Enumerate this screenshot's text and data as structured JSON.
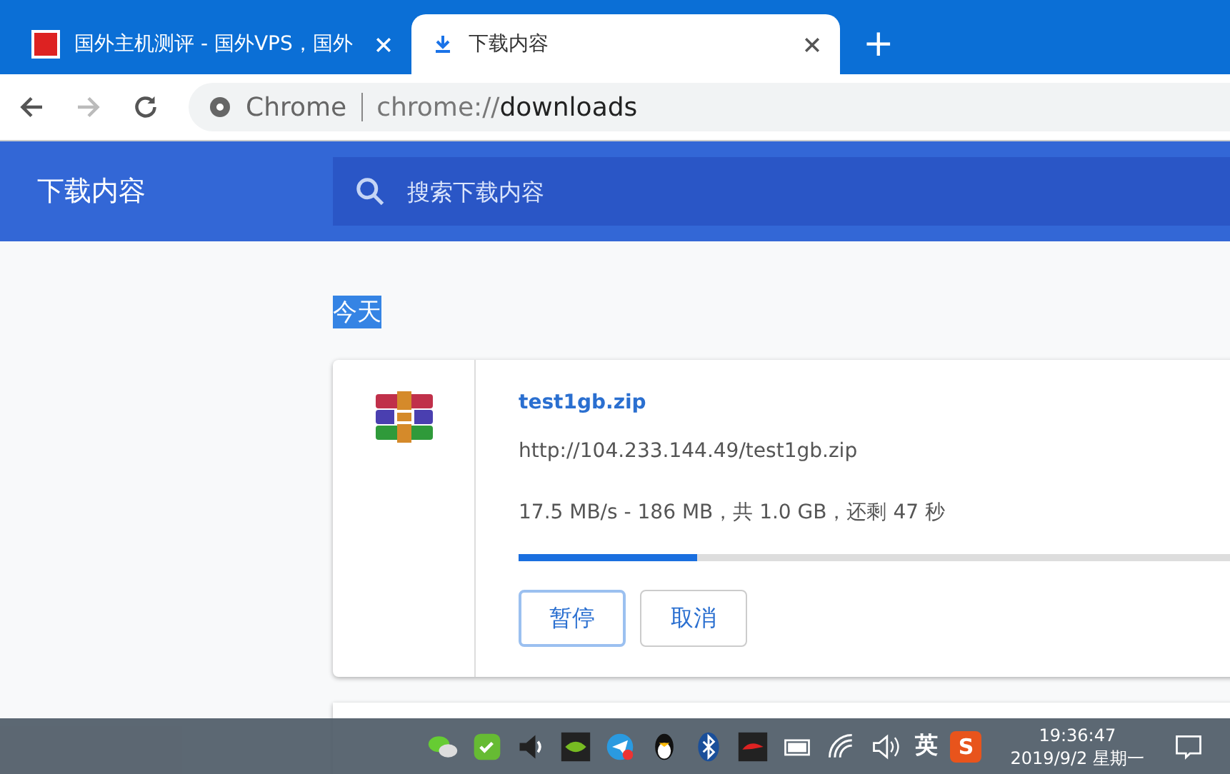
{
  "tabs": [
    {
      "title": "国外主机测评 - 国外VPS，国外",
      "selected": false,
      "kind": "site"
    },
    {
      "title": "下载内容",
      "selected": true,
      "kind": "download"
    }
  ],
  "new_tab": "+",
  "address_bar": {
    "origin": "Chrome",
    "url_prefix": "chrome://",
    "url_path": "downloads"
  },
  "header": {
    "title": "下载内容",
    "search": {
      "placeholder": "搜索下载内容"
    }
  },
  "date_group": {
    "label": "今天",
    "highlighted": true
  },
  "download": {
    "file_name": "test1gb.zip",
    "url": "http://104.233.144.49/test1gb.zip",
    "status": "17.5 MB/s - 186 MB，共 1.0 GB，还剩 47 秒",
    "level": 0.22,
    "buttons": [
      {
        "label": "暂停",
        "focused": true
      },
      {
        "label": "取消",
        "focused": false
      }
    ]
  },
  "taskbar": {
    "tray": [
      {
        "kind": "wechat"
      },
      {
        "kind": "shield"
      },
      {
        "kind": "speaker"
      },
      {
        "kind": "gpu"
      },
      {
        "kind": "plane"
      },
      {
        "kind": "penguin"
      },
      {
        "kind": "bluetooth"
      },
      {
        "kind": "red-app"
      },
      {
        "kind": "battery"
      },
      {
        "kind": "wifi"
      },
      {
        "kind": "volume"
      },
      {
        "kind": "ime",
        "text": "英"
      },
      {
        "kind": "sogou",
        "text": "S"
      }
    ],
    "time": "19:36:47",
    "date": "2019/9/2 星期一"
  }
}
